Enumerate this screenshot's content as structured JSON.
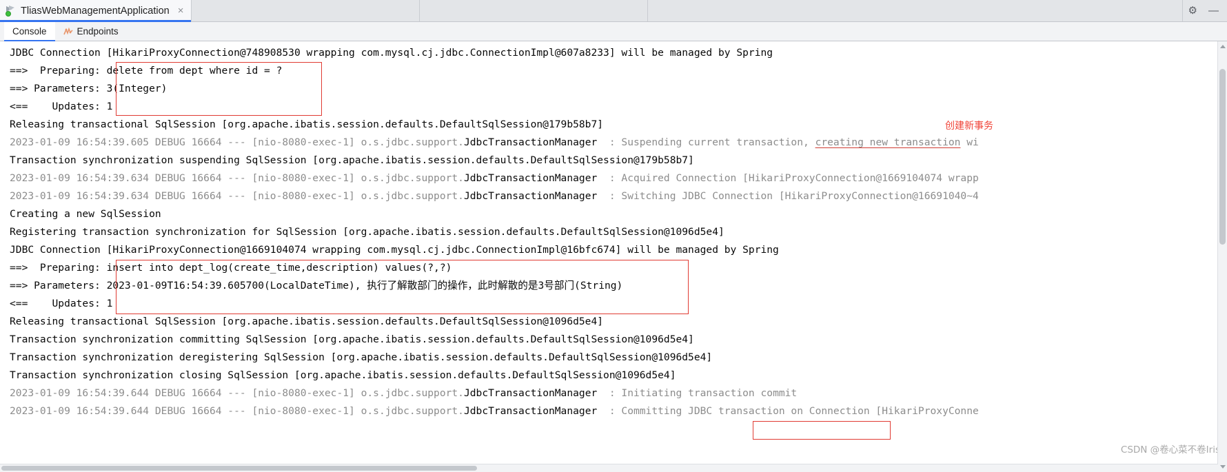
{
  "window": {
    "tabs": [
      {
        "label": "TliasWebManagementApplication",
        "icon": "run-config-icon",
        "close": "×",
        "active": true
      }
    ],
    "controls": {
      "settings": "⚙",
      "minimize": "—"
    }
  },
  "subtabs": [
    {
      "label": "Console",
      "icon": "console-icon",
      "active": true
    },
    {
      "label": "Endpoints",
      "icon": "endpoints-icon",
      "active": false
    }
  ],
  "console": {
    "lines": [
      {
        "segments": [
          {
            "text": "JDBC Connection [HikariProxyConnection@748908530 wrapping com.mysql.cj.jdbc.ConnectionImpl@607a8233] will be managed by Spring",
            "style": "normal"
          }
        ]
      },
      {
        "segments": [
          {
            "text": "==>  Preparing: delete from dept where id = ?",
            "style": "normal"
          }
        ]
      },
      {
        "segments": [
          {
            "text": "==> Parameters: 3(Integer)",
            "style": "normal"
          }
        ]
      },
      {
        "segments": [
          {
            "text": "<==    Updates: 1",
            "style": "normal"
          }
        ]
      },
      {
        "segments": [
          {
            "text": "Releasing transactional SqlSession [org.apache.ibatis.session.defaults.DefaultSqlSession@179b58b7]",
            "style": "normal"
          }
        ]
      },
      {
        "segments": [
          {
            "text": "2023-01-09 16:54:39.605 DEBUG 16664 --- [nio-8080-exec-1] o.s.jdbc.support.",
            "style": "gray"
          },
          {
            "text": "JdbcTransactionManager",
            "style": "normal"
          },
          {
            "text": "  : Suspending current transaction, ",
            "style": "gray"
          },
          {
            "text": "creating new transaction",
            "style": "gray-underline"
          },
          {
            "text": " wi",
            "style": "gray"
          }
        ]
      },
      {
        "segments": [
          {
            "text": "Transaction synchronization suspending SqlSession [org.apache.ibatis.session.defaults.DefaultSqlSession@179b58b7]",
            "style": "normal"
          }
        ]
      },
      {
        "segments": [
          {
            "text": "2023-01-09 16:54:39.634 DEBUG 16664 --- [nio-8080-exec-1] o.s.jdbc.support.",
            "style": "gray"
          },
          {
            "text": "JdbcTransactionManager",
            "style": "normal"
          },
          {
            "text": "  : Acquired Connection [HikariProxyConnection@1669104074 wrapp",
            "style": "gray"
          }
        ]
      },
      {
        "segments": [
          {
            "text": "2023-01-09 16:54:39.634 DEBUG 16664 --- [nio-8080-exec-1] o.s.jdbc.support.",
            "style": "gray"
          },
          {
            "text": "JdbcTransactionManager",
            "style": "normal"
          },
          {
            "text": "  : Switching JDBC Connection [HikariProxyConnection@16691040~4",
            "style": "gray"
          }
        ]
      },
      {
        "segments": [
          {
            "text": "Creating a new SqlSession",
            "style": "normal"
          }
        ]
      },
      {
        "segments": [
          {
            "text": "Registering transaction synchronization for SqlSession [org.apache.ibatis.session.defaults.DefaultSqlSession@1096d5e4]",
            "style": "normal"
          }
        ]
      },
      {
        "segments": [
          {
            "text": "JDBC Connection [HikariProxyConnection@1669104074 wrapping com.mysql.cj.jdbc.ConnectionImpl@16bfc674] will be managed by Spring",
            "style": "normal"
          }
        ]
      },
      {
        "segments": [
          {
            "text": "==>  Preparing: insert into dept_log(create_time,description) values(?,?)",
            "style": "normal"
          }
        ]
      },
      {
        "segments": [
          {
            "text": "==> Parameters: 2023-01-09T16:54:39.605700(LocalDateTime), 执行了解散部门的操作，此时解散的是3号部门(String)",
            "style": "normal"
          }
        ]
      },
      {
        "segments": [
          {
            "text": "<==    Updates: 1",
            "style": "normal"
          }
        ]
      },
      {
        "segments": [
          {
            "text": "Releasing transactional SqlSession [org.apache.ibatis.session.defaults.DefaultSqlSession@1096d5e4]",
            "style": "normal"
          }
        ]
      },
      {
        "segments": [
          {
            "text": "Transaction synchronization committing SqlSession [org.apache.ibatis.session.defaults.DefaultSqlSession@1096d5e4]",
            "style": "normal"
          }
        ]
      },
      {
        "segments": [
          {
            "text": "Transaction synchronization deregistering SqlSession [org.apache.ibatis.session.defaults.DefaultSqlSession@1096d5e4]",
            "style": "normal"
          }
        ]
      },
      {
        "segments": [
          {
            "text": "Transaction synchronization closing SqlSession [org.apache.ibatis.session.defaults.DefaultSqlSession@1096d5e4]",
            "style": "normal"
          }
        ]
      },
      {
        "segments": [
          {
            "text": "2023-01-09 16:54:39.644 DEBUG 16664 --- [nio-8080-exec-1] o.s.jdbc.support.",
            "style": "gray"
          },
          {
            "text": "JdbcTransactionManager",
            "style": "normal"
          },
          {
            "text": "  : Initiating ",
            "style": "gray"
          },
          {
            "text": "transaction commit",
            "style": "gray"
          }
        ]
      },
      {
        "segments": [
          {
            "text": "2023-01-09 16:54:39.644 DEBUG 16664 --- [nio-8080-exec-1] o.s.jdbc.support.",
            "style": "gray"
          },
          {
            "text": "JdbcTransactionManager",
            "style": "normal"
          },
          {
            "text": "  : Committing JDBC transaction on Connection [HikariProxyConne",
            "style": "gray"
          }
        ]
      }
    ]
  },
  "annotations": [
    {
      "name": "create-new-transaction-note",
      "text": "创建新事务",
      "color": "#f04438"
    }
  ],
  "watermark": {
    "text": "CSDN @卷心菜不卷Iris"
  }
}
